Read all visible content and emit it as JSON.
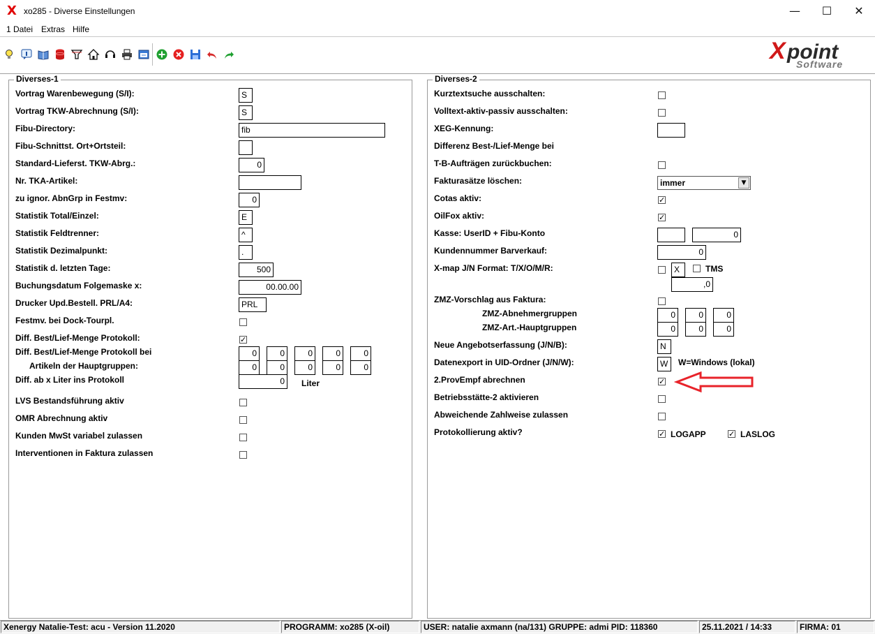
{
  "window": {
    "title": "xo285 - Diverse Einstellungen",
    "icon": "app-x-icon",
    "controls": [
      "minimize-icon",
      "maximize-icon",
      "close-icon"
    ]
  },
  "menu": [
    "1 Datei",
    "Extras",
    "Hilfe"
  ],
  "toolbar": {
    "icons": [
      "lightbulb-icon",
      "info-icon",
      "book-icon",
      "database-icon",
      "filter-icon",
      "home-icon",
      "headset-icon",
      "print-icon",
      "window-icon",
      "add-icon",
      "delete-icon",
      "save-icon",
      "undo-icon",
      "redo-icon"
    ]
  },
  "logo": {
    "main": "Xpoint",
    "sub": "Software"
  },
  "group1": {
    "legend": "Diverses-1",
    "rows": [
      {
        "label": "Vortrag Warenbewegung  (S/I):",
        "value": "S"
      },
      {
        "label": "Vortrag TKW-Abrechnung (S/I):",
        "value": "S"
      },
      {
        "label": "Fibu-Directory:",
        "value": "fib"
      },
      {
        "label": "Fibu-Schnittst. Ort+Ortsteil:",
        "value": ""
      },
      {
        "label": "Standard-Lieferst. TKW-Abrg.:",
        "value": "0"
      },
      {
        "label": "Nr. TKA-Artikel:",
        "value": ""
      },
      {
        "label": "zu ignor. AbnGrp in Festmv:",
        "value": "0"
      },
      {
        "label": "Statistik Total/Einzel:",
        "value": "E"
      },
      {
        "label": "Statistik Feldtrenner:",
        "value": "^"
      },
      {
        "label": "Statistik Dezimalpunkt:",
        "value": "."
      },
      {
        "label": "Statistik d. letzten Tage:",
        "value": "500"
      },
      {
        "label": "Buchungsdatum Folgemaske x:",
        "value": "00.00.00"
      },
      {
        "label": "Drucker Upd.Bestell. PRL/A4:",
        "value": "PRL"
      },
      {
        "label": "Festmv. bei Dock-Tourpl.",
        "checked": false
      },
      {
        "label": "Diff. Best/Lief-Menge Protokoll:",
        "checked": true
      },
      {
        "label": "Diff. Best/Lief-Menge Protokoll bei"
      },
      {
        "label": "Artikeln der Hauptgruppen:"
      },
      {
        "label": "Diff. ab x Liter ins Protokoll",
        "value": "0",
        "unit": "Liter"
      },
      {
        "label": "LVS Bestandsführung aktiv",
        "checked": false
      },
      {
        "label": "OMR Abrechnung aktiv",
        "checked": false
      },
      {
        "label": "Kunden MwSt variabel zulassen",
        "checked": false
      },
      {
        "label": "Interventionen in Faktura zulassen",
        "checked": false
      }
    ],
    "hauptgruppen_row1": [
      "0",
      "0",
      "0",
      "0",
      "0"
    ],
    "hauptgruppen_row2": [
      "0",
      "0",
      "0",
      "0",
      "0"
    ]
  },
  "group2": {
    "legend": "Diverses-2",
    "rows": [
      {
        "label": "Kurztextsuche ausschalten:",
        "checked": false
      },
      {
        "label": "Volltext-aktiv-passiv ausschalten:",
        "checked": false
      },
      {
        "label": "XEG-Kennung:",
        "value": ""
      },
      {
        "label": "Differenz Best-/Lief-Menge bei"
      },
      {
        "label": "T-B-Aufträgen zurückbuchen:",
        "checked": false
      },
      {
        "label": "Fakturasätze löschen:",
        "value": "immer"
      },
      {
        "label": "Cotas aktiv:",
        "checked": true
      },
      {
        "label": "OilFox aktiv:",
        "checked": true
      },
      {
        "label": "Kasse: UserID + Fibu-Konto",
        "value1": "",
        "value2": "0"
      },
      {
        "label": "Kundennummer Barverkauf:",
        "value": "0"
      },
      {
        "label": "X-map J/N  Format: T/X/O/M/R:",
        "checked": false,
        "format": "X",
        "tms_label": "TMS",
        "tms_checked": false,
        "extra": ",0"
      },
      {
        "label": "ZMZ-Vorschlag aus Faktura:",
        "checked": false
      },
      {
        "label": "ZMZ-Abnehmergruppen",
        "values": [
          "0",
          "0",
          "0"
        ]
      },
      {
        "label": "ZMZ-Art.-Hauptgruppen",
        "values": [
          "0",
          "0",
          "0"
        ]
      },
      {
        "label": "Neue Angebotserfassung (J/N/B):",
        "value": "N"
      },
      {
        "label": "Datenexport in UID-Ordner (J/N/W):",
        "value": "W",
        "hint": "W=Windows (lokal)"
      },
      {
        "label": "2.ProvEmpf abrechnen",
        "checked": true
      },
      {
        "label": "Betriebsstätte-2 aktivieren",
        "checked": false
      },
      {
        "label": "Abweichende Zahlweise zulassen",
        "checked": false
      },
      {
        "label": "Protokollierung aktiv?",
        "opt1_label": "LOGAPP",
        "opt1_checked": true,
        "opt2_label": "LASLOG",
        "opt2_checked": true
      }
    ]
  },
  "annotation": {
    "arrow_color": "#e8232a"
  },
  "statusbar": [
    "Xenergy Natalie-Test: acu - Version 11.2020",
    "PROGRAMM: xo285 (X-oil)",
    "USER: natalie axmann (na/131)  GRUPPE: admi  PID: 118360",
    "25.11.2021 / 14:33",
    "FIRMA: 01"
  ],
  "check_mark": "✓"
}
